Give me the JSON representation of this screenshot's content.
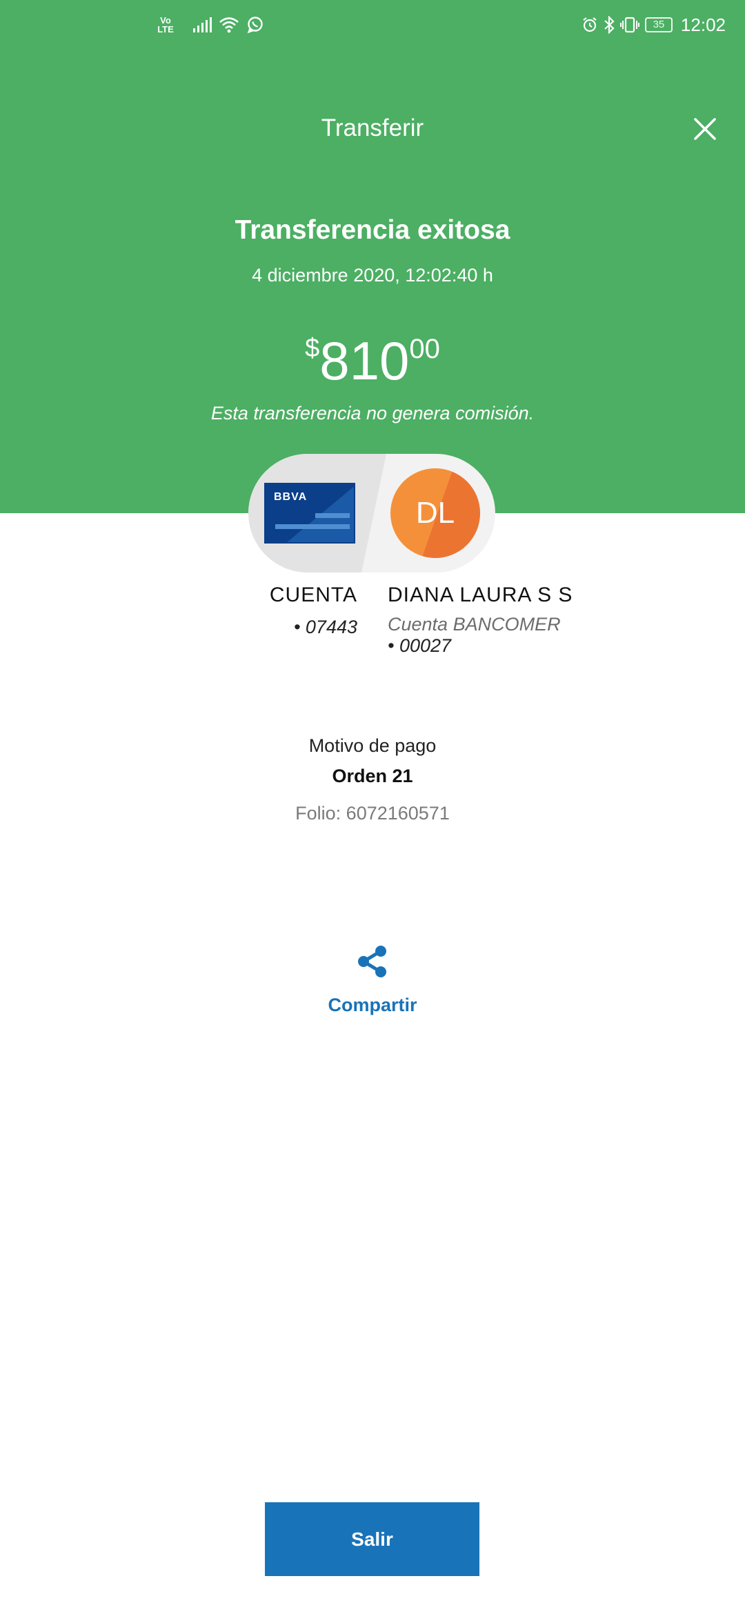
{
  "status_bar": {
    "volte_top": "Vo",
    "volte_bottom": "LTE",
    "battery": "35",
    "time": "12:02",
    "icons": [
      "signal-icon",
      "wifi-icon",
      "whatsapp-icon",
      "alarm-icon",
      "bluetooth-icon",
      "vibrate-icon",
      "battery-icon"
    ]
  },
  "header": {
    "title": "Transferir",
    "close_icon": "close-icon"
  },
  "result": {
    "heading": "Transferencia exitosa",
    "datetime": "4 diciembre 2020, 12:02:40 h",
    "amount_currency": "$",
    "amount_integer": "810",
    "amount_decimals": "00",
    "fee_note": "Esta transferencia no genera comisión."
  },
  "origin": {
    "card_logo": "BBVA",
    "name": "CUENTA",
    "number": "• 07443"
  },
  "destination": {
    "initials": "DL",
    "name": "DIANA LAURA S S",
    "bank": "Cuenta BANCOMER",
    "number": "• 00027"
  },
  "payment": {
    "reason_label": "Motivo de pago",
    "reason_value": "Orden 21",
    "folio": "Folio: 6072160571"
  },
  "actions": {
    "share_label": "Compartir",
    "exit_label": "Salir"
  },
  "colors": {
    "header_green": "#4caf63",
    "accent_blue": "#1973b8",
    "card_blue": "#0b3f8a",
    "avatar_orange": "#f5903a"
  }
}
